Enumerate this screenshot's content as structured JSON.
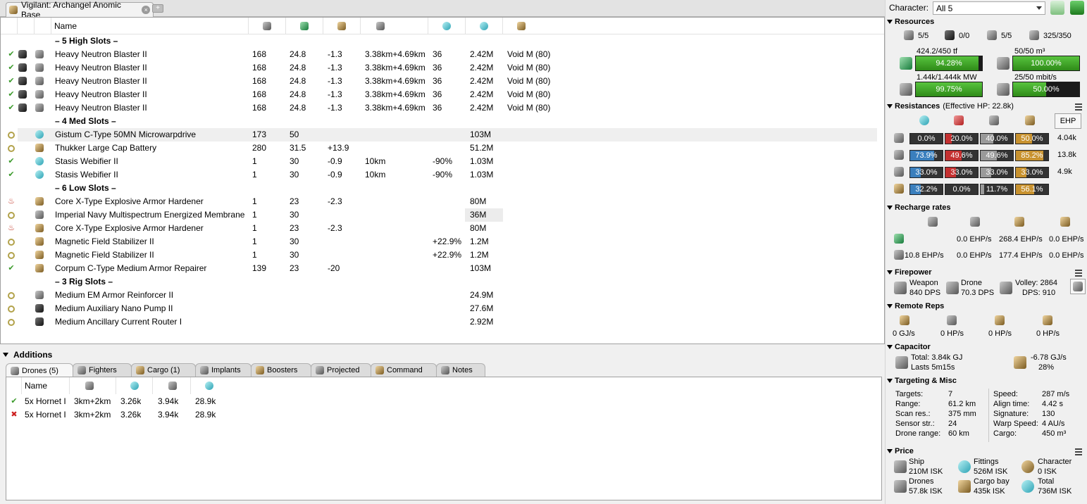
{
  "fit_tab": {
    "title": "Vigilant: Archangel Anomic Base",
    "close": "×",
    "new_tab": "+"
  },
  "modules": {
    "header_name": "Name",
    "racks": [
      {
        "label": "– 5 High Slots –"
      },
      {
        "label": "– 4 Med Slots –"
      },
      {
        "label": "– 6 Low Slots –"
      },
      {
        "label": "– 3 Rig Slots –"
      }
    ],
    "rows": [
      {
        "status": "✔",
        "name": "Heavy Neutron Blaster II",
        "c1": "168",
        "c2": "24.8",
        "c3": "-1.3",
        "c4": "3.38km+4.69km",
        "c5": "36",
        "c6": "2.42M",
        "c7": "Void M (80)"
      },
      {
        "status": "✔",
        "name": "Heavy Neutron Blaster II",
        "c1": "168",
        "c2": "24.8",
        "c3": "-1.3",
        "c4": "3.38km+4.69km",
        "c5": "36",
        "c6": "2.42M",
        "c7": "Void M (80)"
      },
      {
        "status": "✔",
        "name": "Heavy Neutron Blaster II",
        "c1": "168",
        "c2": "24.8",
        "c3": "-1.3",
        "c4": "3.38km+4.69km",
        "c5": "36",
        "c6": "2.42M",
        "c7": "Void M (80)"
      },
      {
        "status": "✔",
        "name": "Heavy Neutron Blaster II",
        "c1": "168",
        "c2": "24.8",
        "c3": "-1.3",
        "c4": "3.38km+4.69km",
        "c5": "36",
        "c6": "2.42M",
        "c7": "Void M (80)"
      },
      {
        "status": "✔",
        "name": "Heavy Neutron Blaster II",
        "c1": "168",
        "c2": "24.8",
        "c3": "-1.3",
        "c4": "3.38km+4.69km",
        "c5": "36",
        "c6": "2.42M",
        "c7": "Void M (80)"
      },
      {
        "status": "",
        "name": "Gistum C-Type 50MN Microwarpdrive",
        "c1": "173",
        "c2": "50",
        "c3": "",
        "c4": "",
        "c5": "",
        "c6": "103M",
        "c7": ""
      },
      {
        "status": "",
        "name": "Thukker Large Cap Battery",
        "c1": "280",
        "c2": "31.5",
        "c3": "+13.9",
        "c4": "",
        "c5": "",
        "c6": "51.2M",
        "c7": ""
      },
      {
        "status": "✔",
        "name": "Stasis Webifier II",
        "c1": "1",
        "c2": "30",
        "c3": "-0.9",
        "c4": "10km",
        "c5": "-90%",
        "c6": "1.03M",
        "c7": ""
      },
      {
        "status": "✔",
        "name": "Stasis Webifier II",
        "c1": "1",
        "c2": "30",
        "c3": "-0.9",
        "c4": "10km",
        "c5": "-90%",
        "c6": "1.03M",
        "c7": ""
      },
      {
        "status": "♨",
        "name": "Core X-Type Explosive Armor Hardener",
        "c1": "1",
        "c2": "23",
        "c3": "-2.3",
        "c4": "",
        "c5": "",
        "c6": "80M",
        "c7": ""
      },
      {
        "status": "",
        "name": "Imperial Navy Multispectrum Energized Membrane",
        "c1": "1",
        "c2": "30",
        "c3": "",
        "c4": "",
        "c5": "",
        "c6": "36M",
        "c7": ""
      },
      {
        "status": "♨",
        "name": "Core X-Type Explosive Armor Hardener",
        "c1": "1",
        "c2": "23",
        "c3": "-2.3",
        "c4": "",
        "c5": "",
        "c6": "80M",
        "c7": ""
      },
      {
        "status": "",
        "name": "Magnetic Field Stabilizer II",
        "c1": "1",
        "c2": "30",
        "c3": "",
        "c4": "",
        "c5": "+22.9%",
        "c6": "1.2M",
        "c7": ""
      },
      {
        "status": "",
        "name": "Magnetic Field Stabilizer II",
        "c1": "1",
        "c2": "30",
        "c3": "",
        "c4": "",
        "c5": "+22.9%",
        "c6": "1.2M",
        "c7": ""
      },
      {
        "status": "✔",
        "name": "Corpum C-Type Medium Armor Repairer",
        "c1": "139",
        "c2": "23",
        "c3": "-20",
        "c4": "",
        "c5": "",
        "c6": "103M",
        "c7": ""
      },
      {
        "status": "",
        "name": "Medium EM Armor Reinforcer II",
        "c1": "",
        "c2": "",
        "c3": "",
        "c4": "",
        "c5": "",
        "c6": "24.9M",
        "c7": ""
      },
      {
        "status": "",
        "name": "Medium Auxiliary Nano Pump II",
        "c1": "",
        "c2": "",
        "c3": "",
        "c4": "",
        "c5": "",
        "c6": "27.6M",
        "c7": ""
      },
      {
        "status": "",
        "name": "Medium Ancillary Current Router I",
        "c1": "",
        "c2": "",
        "c3": "",
        "c4": "",
        "c5": "",
        "c6": "2.92M",
        "c7": ""
      }
    ]
  },
  "additions": {
    "title": "Additions",
    "tabs": [
      "Drones (5)",
      "Fighters",
      "Cargo (1)",
      "Implants",
      "Boosters",
      "Projected",
      "Command",
      "Notes"
    ],
    "drone_header_name": "Name",
    "drones": [
      {
        "status": "✔",
        "name": "5x Hornet I",
        "range": "3km+2km",
        "c2": "3.26k",
        "c3": "3.94k",
        "c4": "28.9k"
      },
      {
        "status": "✖",
        "name": "5x Hornet I",
        "range": "3km+2km",
        "c2": "3.26k",
        "c3": "3.94k",
        "c4": "28.9k"
      }
    ]
  },
  "character": {
    "label": "Character:",
    "value": "All 5"
  },
  "resources": {
    "title": "Resources",
    "counts": [
      "5/5",
      "0/0",
      "5/5",
      "325/350"
    ],
    "cpu": {
      "label": "424.2/450 tf",
      "pct": "94.28%",
      "fill": 0.9428
    },
    "drone_bay": {
      "label": "50/50 m³",
      "pct": "100.00%",
      "fill": 1.0
    },
    "power": {
      "label": "1.44k/1.444k MW",
      "pct": "99.75%",
      "fill": 0.9975
    },
    "bandwidth": {
      "label": "25/50 mbit/s",
      "pct": "50.00%",
      "fill": 0.5
    }
  },
  "resistances": {
    "title": "Resistances",
    "ehp_note": "(Effective HP: 22.8k)",
    "ehp_button": "EHP",
    "rows": [
      {
        "em": "0.0%",
        "th": "20.0%",
        "ki": "40.0%",
        "ex": "50.0%",
        "f": [
          0.0,
          0.2,
          0.4,
          0.5
        ],
        "hp": "4.04k"
      },
      {
        "em": "73.9%",
        "th": "49.6%",
        "ki": "49.6%",
        "ex": "85.2%",
        "f": [
          0.739,
          0.496,
          0.496,
          0.852
        ],
        "hp": "13.8k"
      },
      {
        "em": "33.0%",
        "th": "33.0%",
        "ki": "33.0%",
        "ex": "33.0%",
        "f": [
          0.33,
          0.33,
          0.33,
          0.33
        ],
        "hp": "4.9k"
      },
      {
        "em": "32.2%",
        "th": "0.0%",
        "ki": "11.7%",
        "ex": "56.1%",
        "f": [
          0.322,
          0.0,
          0.117,
          0.561
        ],
        "hp": ""
      }
    ]
  },
  "recharge": {
    "title": "Recharge rates",
    "row1": [
      "0.0 EHP/s",
      "268.4 EHP/s",
      "0.0 EHP/s"
    ],
    "row2": [
      "10.8 EHP/s",
      "0.0 EHP/s",
      "177.4 EHP/s",
      "0.0 EHP/s"
    ]
  },
  "firepower": {
    "title": "Firepower",
    "weapon_label": "Weapon",
    "weapon_dps": "840 DPS",
    "drone_label": "Drone",
    "drone_dps": "70.3 DPS",
    "volley": "Volley: 2864",
    "dps": "DPS: 910"
  },
  "remote_reps": {
    "title": "Remote Reps",
    "values": [
      "0 GJ/s",
      "0 HP/s",
      "0 HP/s",
      "0 HP/s"
    ]
  },
  "capacitor": {
    "title": "Capacitor",
    "total": "Total: 3.84k GJ",
    "lasts": "Lasts 5m15s",
    "rate": "-6.78 GJ/s",
    "pct": "28%"
  },
  "targeting": {
    "title": "Targeting & Misc",
    "left": [
      [
        "Targets:",
        "7"
      ],
      [
        "Range:",
        "61.2 km"
      ],
      [
        "Scan res.:",
        "375 mm"
      ],
      [
        "Sensor str.:",
        "24"
      ],
      [
        "Drone range:",
        "60 km"
      ]
    ],
    "right": [
      [
        "Speed:",
        "287 m/s"
      ],
      [
        "Align time:",
        "4.42 s"
      ],
      [
        "Signature:",
        "130"
      ],
      [
        "Warp Speed:",
        "4 AU/s"
      ],
      [
        "Cargo:",
        "450 m³"
      ]
    ]
  },
  "price": {
    "title": "Price",
    "items": [
      {
        "label": "Ship",
        "value": "210M ISK"
      },
      {
        "label": "Fittings",
        "value": "526M ISK"
      },
      {
        "label": "Character",
        "value": "0 ISK"
      },
      {
        "label": "Drones",
        "value": "57.8k ISK"
      },
      {
        "label": "Cargo bay",
        "value": "435k ISK"
      },
      {
        "label": "Total",
        "value": "736M ISK"
      }
    ]
  }
}
